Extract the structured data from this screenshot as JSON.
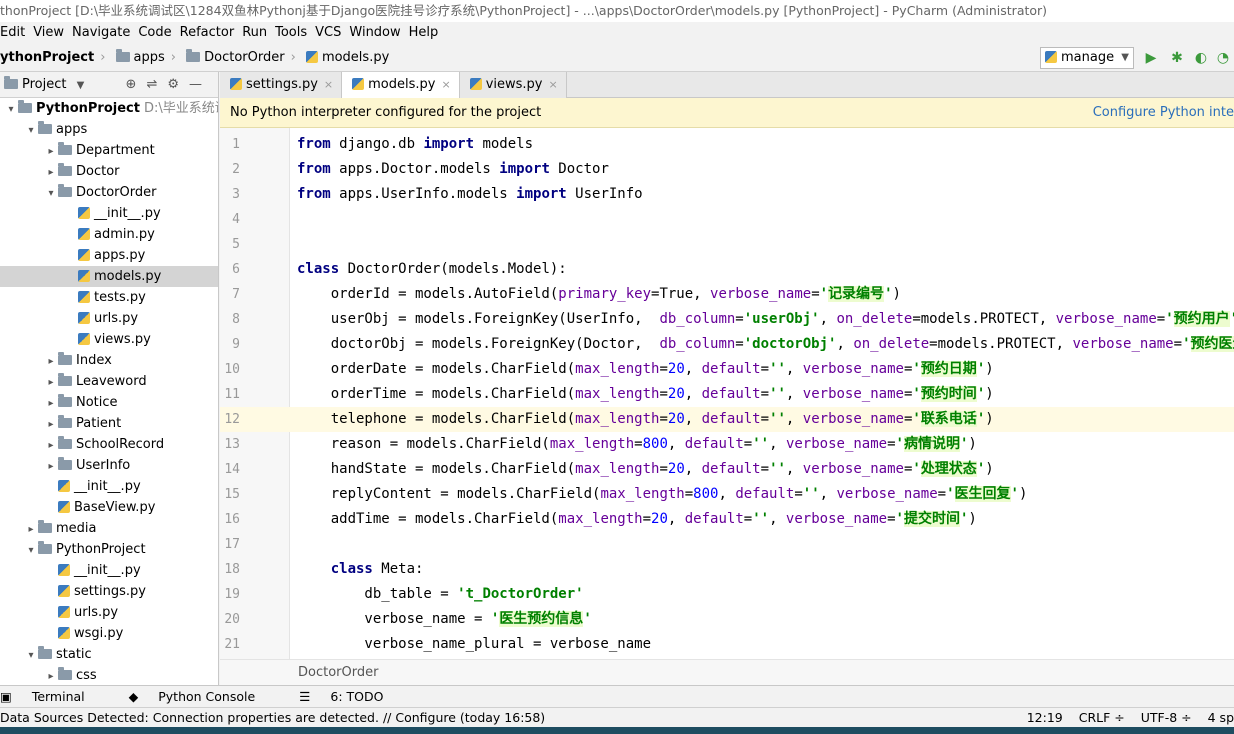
{
  "window": {
    "title": "thonProject [D:\\毕业系统调试区\\1284双鱼林Pythonj基于Django医院挂号诊疗系统\\PythonProject] - ...\\apps\\DoctorOrder\\models.py [PythonProject] - PyCharm (Administrator)"
  },
  "menu": [
    "Edit",
    "View",
    "Navigate",
    "Code",
    "Refactor",
    "Run",
    "Tools",
    "VCS",
    "Window",
    "Help"
  ],
  "breadcrumb": [
    "ythonProject",
    "apps",
    "DoctorOrder",
    "models.py"
  ],
  "run_config": {
    "label": "manage"
  },
  "project_panel": {
    "title": "Project",
    "tree": [
      {
        "label": "PythonProject",
        "note": "D:\\毕业系统调试区",
        "indent": 0,
        "type": "folder",
        "arrow": "▾",
        "bold": true
      },
      {
        "label": "apps",
        "indent": 1,
        "type": "folder",
        "arrow": "▾"
      },
      {
        "label": "Department",
        "indent": 2,
        "type": "folder",
        "arrow": "▸"
      },
      {
        "label": "Doctor",
        "indent": 2,
        "type": "folder",
        "arrow": "▸"
      },
      {
        "label": "DoctorOrder",
        "indent": 2,
        "type": "folder",
        "arrow": "▾"
      },
      {
        "label": "__init__.py",
        "indent": 3,
        "type": "py"
      },
      {
        "label": "admin.py",
        "indent": 3,
        "type": "py"
      },
      {
        "label": "apps.py",
        "indent": 3,
        "type": "py"
      },
      {
        "label": "models.py",
        "indent": 3,
        "type": "py",
        "selected": true
      },
      {
        "label": "tests.py",
        "indent": 3,
        "type": "py"
      },
      {
        "label": "urls.py",
        "indent": 3,
        "type": "py"
      },
      {
        "label": "views.py",
        "indent": 3,
        "type": "py"
      },
      {
        "label": "Index",
        "indent": 2,
        "type": "folder",
        "arrow": "▸"
      },
      {
        "label": "Leaveword",
        "indent": 2,
        "type": "folder",
        "arrow": "▸"
      },
      {
        "label": "Notice",
        "indent": 2,
        "type": "folder",
        "arrow": "▸"
      },
      {
        "label": "Patient",
        "indent": 2,
        "type": "folder",
        "arrow": "▸"
      },
      {
        "label": "SchoolRecord",
        "indent": 2,
        "type": "folder",
        "arrow": "▸"
      },
      {
        "label": "UserInfo",
        "indent": 2,
        "type": "folder",
        "arrow": "▸"
      },
      {
        "label": "__init__.py",
        "indent": 2,
        "type": "py"
      },
      {
        "label": "BaseView.py",
        "indent": 2,
        "type": "py"
      },
      {
        "label": "media",
        "indent": 1,
        "type": "folder",
        "arrow": "▸"
      },
      {
        "label": "PythonProject",
        "indent": 1,
        "type": "folder",
        "arrow": "▾"
      },
      {
        "label": "__init__.py",
        "indent": 2,
        "type": "py"
      },
      {
        "label": "settings.py",
        "indent": 2,
        "type": "py"
      },
      {
        "label": "urls.py",
        "indent": 2,
        "type": "py"
      },
      {
        "label": "wsgi.py",
        "indent": 2,
        "type": "py"
      },
      {
        "label": "static",
        "indent": 1,
        "type": "folder",
        "arrow": "▾"
      },
      {
        "label": "css",
        "indent": 2,
        "type": "folder",
        "arrow": "▸"
      }
    ]
  },
  "tabs": [
    {
      "label": "settings.py",
      "active": false
    },
    {
      "label": "models.py",
      "active": true
    },
    {
      "label": "views.py",
      "active": false
    }
  ],
  "notice": {
    "message": "No Python interpreter configured for the project",
    "action": "Configure Python inte"
  },
  "code_lines": [
    [
      [
        "kw",
        "from"
      ],
      [
        "t",
        " django.db "
      ],
      [
        "kw",
        "import"
      ],
      [
        "t",
        " models"
      ]
    ],
    [
      [
        "kw",
        "from"
      ],
      [
        "t",
        " apps.Doctor.models "
      ],
      [
        "kw",
        "import"
      ],
      [
        "t",
        " Doctor"
      ]
    ],
    [
      [
        "kw",
        "from"
      ],
      [
        "t",
        " apps.UserInfo.models "
      ],
      [
        "kw",
        "import"
      ],
      [
        "t",
        " UserInfo"
      ]
    ],
    [],
    [],
    [
      [
        "kw",
        "class"
      ],
      [
        "t",
        " DoctorOrder(models.Model):"
      ]
    ],
    [
      [
        "t",
        "    orderId = models.AutoField("
      ],
      [
        "kwd",
        "primary_key"
      ],
      [
        "t",
        "=True, "
      ],
      [
        "kwd",
        "verbose_name"
      ],
      [
        "t",
        "="
      ],
      [
        "str",
        "'"
      ],
      [
        "cn",
        "记录编号"
      ],
      [
        "str",
        "'"
      ],
      [
        "t",
        ")"
      ]
    ],
    [
      [
        "t",
        "    userObj = models.ForeignKey(UserInfo,  "
      ],
      [
        "kwd",
        "db_column"
      ],
      [
        "t",
        "="
      ],
      [
        "str",
        "'userObj'"
      ],
      [
        "t",
        ", "
      ],
      [
        "kwd",
        "on_delete"
      ],
      [
        "t",
        "=models.PROTECT, "
      ],
      [
        "kwd",
        "verbose_name"
      ],
      [
        "t",
        "="
      ],
      [
        "str",
        "'"
      ],
      [
        "cn",
        "预约用户"
      ],
      [
        "str",
        "'"
      ],
      [
        "t",
        ")"
      ]
    ],
    [
      [
        "t",
        "    doctorObj = models.ForeignKey(Doctor,  "
      ],
      [
        "kwd",
        "db_column"
      ],
      [
        "t",
        "="
      ],
      [
        "str",
        "'doctorObj'"
      ],
      [
        "t",
        ", "
      ],
      [
        "kwd",
        "on_delete"
      ],
      [
        "t",
        "=models.PROTECT, "
      ],
      [
        "kwd",
        "verbose_name"
      ],
      [
        "t",
        "="
      ],
      [
        "str",
        "'"
      ],
      [
        "cn",
        "预约医生"
      ],
      [
        "str",
        "'"
      ],
      [
        "t",
        ")"
      ]
    ],
    [
      [
        "t",
        "    orderDate = models.CharField("
      ],
      [
        "kwd",
        "max_length"
      ],
      [
        "t",
        "="
      ],
      [
        "num",
        "20"
      ],
      [
        "t",
        ", "
      ],
      [
        "kwd",
        "default"
      ],
      [
        "t",
        "="
      ],
      [
        "str",
        "''"
      ],
      [
        "t",
        ", "
      ],
      [
        "kwd",
        "verbose_name"
      ],
      [
        "t",
        "="
      ],
      [
        "str",
        "'"
      ],
      [
        "cn",
        "预约日期"
      ],
      [
        "str",
        "'"
      ],
      [
        "t",
        ")"
      ]
    ],
    [
      [
        "t",
        "    orderTime = models.CharField("
      ],
      [
        "kwd",
        "max_length"
      ],
      [
        "t",
        "="
      ],
      [
        "num",
        "20"
      ],
      [
        "t",
        ", "
      ],
      [
        "kwd",
        "default"
      ],
      [
        "t",
        "="
      ],
      [
        "str",
        "''"
      ],
      [
        "t",
        ", "
      ],
      [
        "kwd",
        "verbose_name"
      ],
      [
        "t",
        "="
      ],
      [
        "str",
        "'"
      ],
      [
        "cn",
        "预约时间"
      ],
      [
        "str",
        "'"
      ],
      [
        "t",
        ")"
      ]
    ],
    [
      [
        "t",
        "    telephone = models.CharField("
      ],
      [
        "kwd",
        "max_length"
      ],
      [
        "t",
        "="
      ],
      [
        "num",
        "20"
      ],
      [
        "t",
        ", "
      ],
      [
        "kwd",
        "default"
      ],
      [
        "t",
        "="
      ],
      [
        "str",
        "''"
      ],
      [
        "t",
        ", "
      ],
      [
        "kwd",
        "verbose_name"
      ],
      [
        "t",
        "="
      ],
      [
        "str",
        "'"
      ],
      [
        "cn",
        "联系电话"
      ],
      [
        "str",
        "'"
      ],
      [
        "t",
        ")"
      ]
    ],
    [
      [
        "t",
        "    reason = models.CharField("
      ],
      [
        "kwd",
        "max_length"
      ],
      [
        "t",
        "="
      ],
      [
        "num",
        "800"
      ],
      [
        "t",
        ", "
      ],
      [
        "kwd",
        "default"
      ],
      [
        "t",
        "="
      ],
      [
        "str",
        "''"
      ],
      [
        "t",
        ", "
      ],
      [
        "kwd",
        "verbose_name"
      ],
      [
        "t",
        "="
      ],
      [
        "str",
        "'"
      ],
      [
        "cn",
        "病情说明"
      ],
      [
        "str",
        "'"
      ],
      [
        "t",
        ")"
      ]
    ],
    [
      [
        "t",
        "    handState = models.CharField("
      ],
      [
        "kwd",
        "max_length"
      ],
      [
        "t",
        "="
      ],
      [
        "num",
        "20"
      ],
      [
        "t",
        ", "
      ],
      [
        "kwd",
        "default"
      ],
      [
        "t",
        "="
      ],
      [
        "str",
        "''"
      ],
      [
        "t",
        ", "
      ],
      [
        "kwd",
        "verbose_name"
      ],
      [
        "t",
        "="
      ],
      [
        "str",
        "'"
      ],
      [
        "cn",
        "处理状态"
      ],
      [
        "str",
        "'"
      ],
      [
        "t",
        ")"
      ]
    ],
    [
      [
        "t",
        "    replyContent = models.CharField("
      ],
      [
        "kwd",
        "max_length"
      ],
      [
        "t",
        "="
      ],
      [
        "num",
        "800"
      ],
      [
        "t",
        ", "
      ],
      [
        "kwd",
        "default"
      ],
      [
        "t",
        "="
      ],
      [
        "str",
        "''"
      ],
      [
        "t",
        ", "
      ],
      [
        "kwd",
        "verbose_name"
      ],
      [
        "t",
        "="
      ],
      [
        "str",
        "'"
      ],
      [
        "cn",
        "医生回复"
      ],
      [
        "str",
        "'"
      ],
      [
        "t",
        ")"
      ]
    ],
    [
      [
        "t",
        "    addTime = models.CharField("
      ],
      [
        "kwd",
        "max_length"
      ],
      [
        "t",
        "="
      ],
      [
        "num",
        "20"
      ],
      [
        "t",
        ", "
      ],
      [
        "kwd",
        "default"
      ],
      [
        "t",
        "="
      ],
      [
        "str",
        "''"
      ],
      [
        "t",
        ", "
      ],
      [
        "kwd",
        "verbose_name"
      ],
      [
        "t",
        "="
      ],
      [
        "str",
        "'"
      ],
      [
        "cn",
        "提交时间"
      ],
      [
        "str",
        "'"
      ],
      [
        "t",
        ")"
      ]
    ],
    [],
    [
      [
        "t",
        "    "
      ],
      [
        "kw",
        "class"
      ],
      [
        "t",
        " Meta:"
      ]
    ],
    [
      [
        "t",
        "        db_table = "
      ],
      [
        "str",
        "'t_DoctorOrder'"
      ]
    ],
    [
      [
        "t",
        "        verbose_name = "
      ],
      [
        "str",
        "'"
      ],
      [
        "cn",
        "医生预约信息"
      ],
      [
        "str",
        "'"
      ]
    ],
    [
      [
        "t",
        "        verbose_name_plural = verbose_name"
      ]
    ]
  ],
  "current_line": 12,
  "editor_breadcrumb": "DoctorOrder",
  "tool_tabs": [
    "Terminal",
    "Python Console",
    "6: TODO"
  ],
  "status": {
    "message": "Data Sources Detected: Connection properties are detected. // Configure (today 16:58)",
    "position": "12:19",
    "line_sep": "CRLF ÷",
    "encoding": "UTF-8 ÷",
    "indent": "4 sp"
  }
}
